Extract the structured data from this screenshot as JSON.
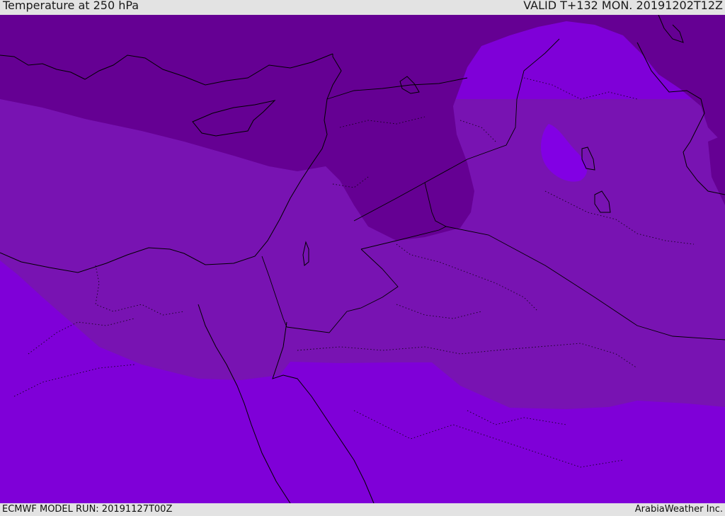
{
  "header": {
    "title": "Temperature at 250 hPa",
    "valid": "VALID T+132 MON. 20191202T12Z"
  },
  "footer": {
    "model_run": "ECMWF MODEL RUN: 20191127T00Z",
    "credit": "ArabiaWeather Inc."
  },
  "map": {
    "parameter": "Temperature",
    "level": "250 hPa",
    "shading_colors": {
      "coldest_band": "#650093",
      "middle_band": "#7813b2",
      "cool_pocket": "#8200e4",
      "warmest_band": "#7f00d8"
    }
  }
}
